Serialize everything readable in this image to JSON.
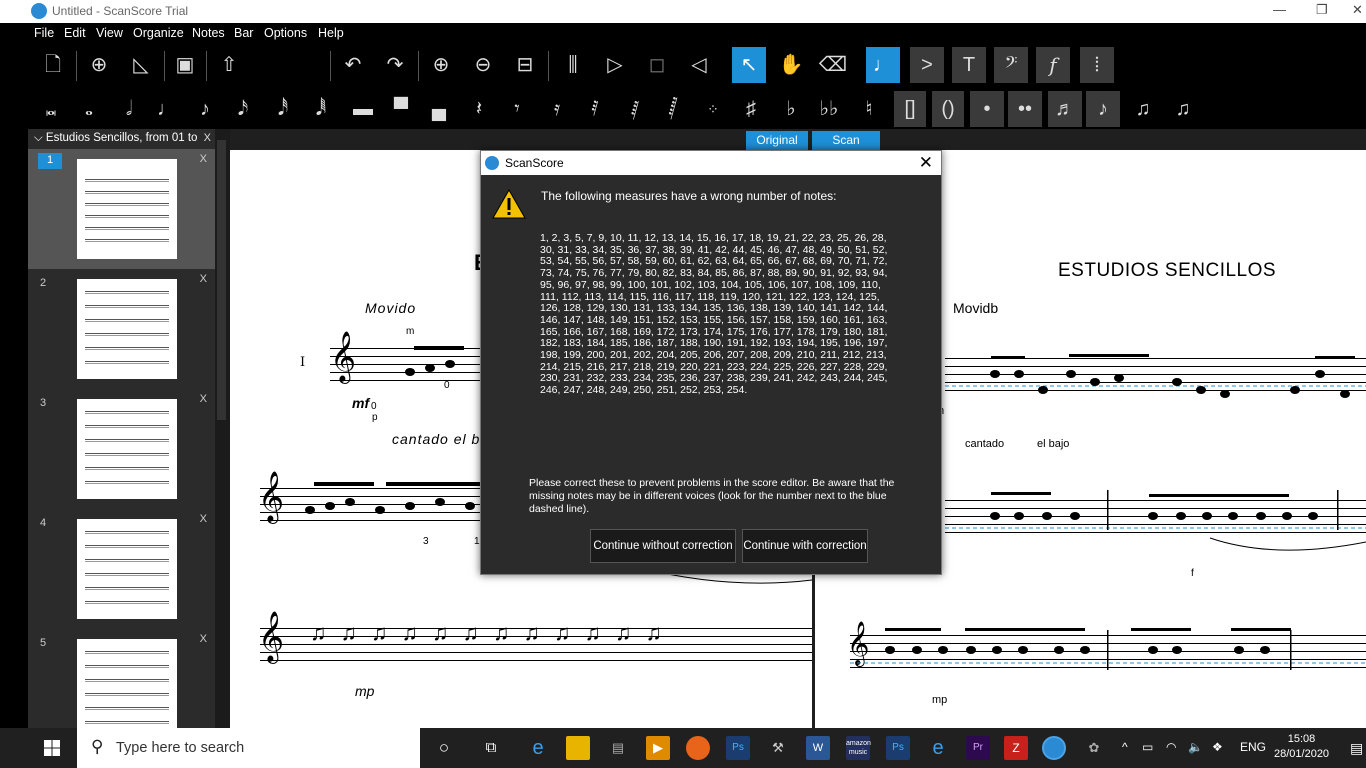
{
  "window": {
    "title": "Untitled - ScanScore Trial",
    "minimize": "—",
    "restore": "❐",
    "close": "✕"
  },
  "menu": [
    "File",
    "Edit",
    "View",
    "Organize",
    "Notes",
    "Bar",
    "Options",
    "Help"
  ],
  "sidebar": {
    "title": "Estudios Sencillos, from 01 to",
    "close": "X",
    "pages": [
      {
        "num": "1",
        "close": "X"
      },
      {
        "num": "2",
        "close": "X"
      },
      {
        "num": "3",
        "close": "X"
      },
      {
        "num": "4",
        "close": "X"
      },
      {
        "num": "5",
        "close": "X"
      }
    ]
  },
  "tabs": {
    "original": "Original",
    "scan": "Scan"
  },
  "score_left": {
    "tempo": "Movido",
    "roman": "I",
    "dynamic": "mf",
    "cantado": "cantado el b",
    "fingering_m": "m",
    "fingering_p": "p",
    "fingering_0a": "0",
    "fingering_0b": "0",
    "fingering_3": "3",
    "fingering_1": "1",
    "dynamic2": "mp"
  },
  "score_right": {
    "title": "ESTUDIOS SENCILLOS",
    "tempo": "Movidb",
    "cantado": "cantado",
    "el_bajo": "el bajo",
    "letter_m": "m",
    "f_mark": "f",
    "dynamic2": "mp"
  },
  "dialog": {
    "title": "ScanScore",
    "close": "✕",
    "message": "The following measures have a wrong number of notes:",
    "measures": "1, 2, 3, 5, 7, 9, 10, 11, 12, 13, 14, 15, 16, 17, 18, 19, 21, 22, 23, 25, 26, 28, 30, 31, 33, 34, 35, 36, 37, 38, 39, 41, 42, 44, 45, 46, 47, 48, 49, 50, 51, 52, 53, 54, 55, 56, 57, 58, 59, 60, 61, 62, 63, 64, 65, 66, 67, 68, 69, 70, 71, 72, 73, 74, 75, 76, 77, 79, 80, 82, 83, 84, 85, 86, 87, 88, 89, 90, 91, 92, 93, 94, 95, 96, 97, 98, 99, 100, 101, 102, 103, 104, 105, 106, 107, 108, 109, 110, 111, 112, 113, 114, 115, 116, 117, 118, 119, 120, 121, 122, 123, 124, 125, 126, 128, 129, 130, 131, 133, 134, 135, 136, 138, 139, 140, 141, 142, 144, 146, 147, 148, 149, 151, 152, 153, 155, 156, 157, 158, 159, 160, 161, 163, 165, 166, 167, 168, 169, 172, 173, 174, 175, 176, 177, 178, 179, 180, 181, 182, 183, 184, 185, 186, 187, 188, 190, 191, 192, 193, 194, 195, 196, 197, 198, 199, 200, 201, 202, 204, 205, 206, 207, 208, 209, 210, 211, 212, 213, 214, 215, 216, 217, 218, 219, 220, 221, 223, 224, 225, 226, 227, 228, 229, 230, 231, 232, 233, 234, 235, 236, 237, 238, 239, 241, 242, 243, 244, 245, 246, 247, 248, 249, 250, 251, 252, 253, 254.",
    "note": "Please correct these to prevent problems in the score editor. Be aware that the missing notes may be in different voices (look for the number next to the blue dashed line).",
    "btn_without": "Continue without correction",
    "btn_with": "Continue with correction"
  },
  "taskbar": {
    "search_placeholder": "Type here to search",
    "lang": "ENG",
    "time": "15:08",
    "date": "28/01/2020"
  },
  "colors": {
    "accent": "#1e90d8",
    "toolbar_bg": "#000000",
    "panel_bg": "#2b2b2b"
  }
}
